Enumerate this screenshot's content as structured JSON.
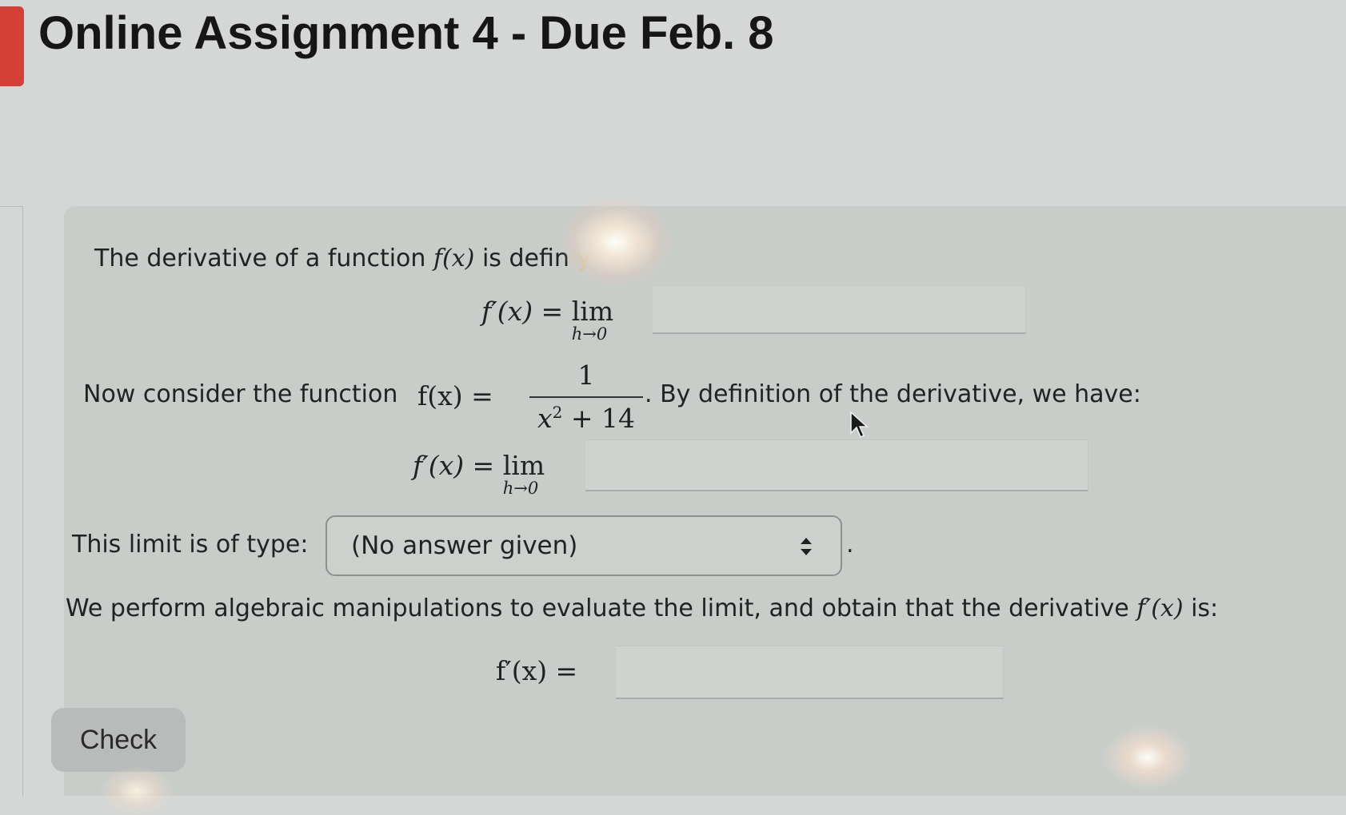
{
  "assignment": {
    "title": "Online Assignment 4 - Due Feb. 8"
  },
  "colors": {
    "accent": "#d63f35",
    "card": "#c9cdca",
    "background": "#d4d7d5"
  },
  "problem": {
    "intro_prefix": "The derivative of a function",
    "intro_func": "f(x)",
    "intro_suffix": "is defin",
    "intro_tail": "y",
    "definition_lhs": "f′(x) =",
    "lim": "lim",
    "lim_sub": "h→0",
    "consider_prefix": "Now consider the function",
    "consider_func": "f(x) =",
    "fraction_numerator": "1",
    "fraction_denominator": "x",
    "fraction_exponent": "2",
    "fraction_den_rest": " + 14",
    "consider_suffix": ". By definition of the derivative, we have:",
    "limit_type_label": "This limit is of type:",
    "limit_type_selected": "(No answer given)",
    "manipulation_prefix": "We perform algebraic manipulations to evaluate the limit, and obtain that the derivative",
    "manipulation_func": "f′(x)",
    "manipulation_suffix": "is:",
    "final_lhs": "f′(x) =",
    "period": "."
  },
  "actions": {
    "check_label": "Check"
  },
  "icons": {
    "select_arrow": "up-down-arrow-icon",
    "cursor": "mouse-pointer-icon"
  }
}
